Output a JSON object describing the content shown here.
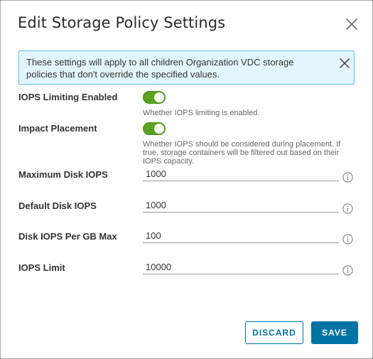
{
  "dialog": {
    "title": "Edit Storage Policy Settings"
  },
  "alert": {
    "text": "These settings will apply to all children Organization VDC storage policies that don't override the specified values."
  },
  "fields": {
    "iops_limiting": {
      "label": "IOPS Limiting Enabled",
      "enabled": true,
      "helper": "Whether IOPS limiting is enabled."
    },
    "impact_placement": {
      "label": "Impact Placement",
      "enabled": true,
      "helper": "Whether IOPS should be considered during placement. If true, storage containers will be filtered out based on their IOPS capacity."
    },
    "max_disk_iops": {
      "label": "Maximum Disk IOPS",
      "value": "1000"
    },
    "default_disk_iops": {
      "label": "Default Disk IOPS",
      "value": "1000"
    },
    "disk_iops_per_gb": {
      "label": "Disk IOPS Per GB Max",
      "value": "100"
    },
    "iops_limit": {
      "label": "IOPS Limit",
      "value": "10000"
    }
  },
  "buttons": {
    "discard": "DISCARD",
    "save": "SAVE"
  },
  "colors": {
    "accent": "#0072a3",
    "toggle_on": "#5aa220",
    "alert_bg": "#e3f5fc",
    "alert_border": "#5dc1e8"
  },
  "icons": {
    "close": "close-icon",
    "alert_close": "close-icon",
    "info": "info-icon"
  }
}
